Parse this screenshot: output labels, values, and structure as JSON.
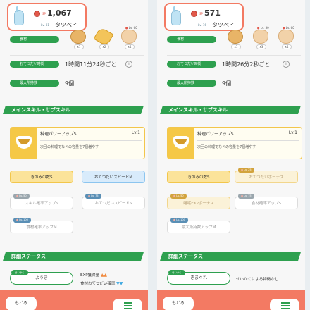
{
  "left": {
    "pokemon": {
      "sp_label": "SP",
      "sp": "1,067",
      "lv": "Lv. 31",
      "name": "タツベイ"
    },
    "ingredients": {
      "label": "食材",
      "slots": [
        {
          "kind": "bread",
          "count": "x1",
          "lv": ""
        },
        {
          "kind": "leaf",
          "count": "x2",
          "lv": ""
        },
        {
          "kind": "paw",
          "count": "x4",
          "lv": "Lv. 60"
        }
      ]
    },
    "help_time": {
      "label": "おてつだい時間",
      "value": "1時間11分24秒ごと"
    },
    "max_inventory": {
      "label": "最大所持数",
      "value": "9個"
    },
    "skills_section": "メインスキル・サブスキル",
    "main_skill": {
      "name": "料理パワーアップS",
      "lv": "Lv.1",
      "desc": "次回の料理でなべの容量を7個増やす"
    },
    "sub_skills": [
      {
        "label": "きのみの数S",
        "tag": "",
        "style": "gold"
      },
      {
        "label": "おてつだいスピードM",
        "tag": "",
        "style": "blue"
      },
      {
        "label": "スキル確率アップS",
        "tag": "Lv. 50",
        "style": "gray"
      },
      {
        "label": "おてつだいスピードS",
        "tag": "Lv. 75",
        "style": "gray"
      },
      {
        "label": "食材確率アップM",
        "tag": "Lv. 100",
        "style": "gray"
      }
    ],
    "detail_section": "詳細ステータス",
    "nature": {
      "tag": "せいかく",
      "name": "ようき"
    },
    "nature_effects": [
      {
        "label": "EXP獲得量",
        "arrows": "▲▲"
      },
      {
        "label": "食材おてつだい確率",
        "arrows": "▼▼"
      }
    ],
    "back": "もどる"
  },
  "right": {
    "pokemon": {
      "sp_label": "SP",
      "sp": "571",
      "lv": "Lv. 16",
      "name": "タツベイ"
    },
    "ingredients": {
      "label": "食材",
      "slots": [
        {
          "kind": "bread",
          "count": "x1",
          "lv": ""
        },
        {
          "kind": "paw",
          "count": "x3",
          "lv": "Lv. 30"
        },
        {
          "kind": "paw",
          "count": "x4",
          "lv": "Lv. 60"
        }
      ]
    },
    "help_time": {
      "label": "おてつだい時間",
      "value": "1時間26分2秒ごと"
    },
    "max_inventory": {
      "label": "最大所持数",
      "value": "9個"
    },
    "skills_section": "メインスキル・サブスキル",
    "main_skill": {
      "name": "料理パワーアップS",
      "lv": "Lv.1",
      "desc": "次回の料理でなべの容量を7個増やす"
    },
    "sub_skills": [
      {
        "label": "きのみの数S",
        "tag": "",
        "style": "gold"
      },
      {
        "label": "おてつだいボーナス",
        "tag": "Lv. 25",
        "style": "cream"
      },
      {
        "label": "睡眠EXPボーナス",
        "tag": "Lv. 50",
        "style": "cream"
      },
      {
        "label": "食材確率アップS",
        "tag": "Lv. 75",
        "style": "gray"
      },
      {
        "label": "最大所持数アップM",
        "tag": "Lv. 100",
        "style": "gray"
      }
    ],
    "detail_section": "詳細ステータス",
    "nature": {
      "tag": "せいかく",
      "name": "きまぐれ"
    },
    "nature_effects": [
      {
        "label": "せいかくによる特徴なし",
        "arrows": ""
      }
    ],
    "back": "もどる"
  },
  "colors": {
    "accent": "#f37a63",
    "green": "#2ea04f",
    "gold": "#f2c64b",
    "blue": "#8cc5ef"
  }
}
